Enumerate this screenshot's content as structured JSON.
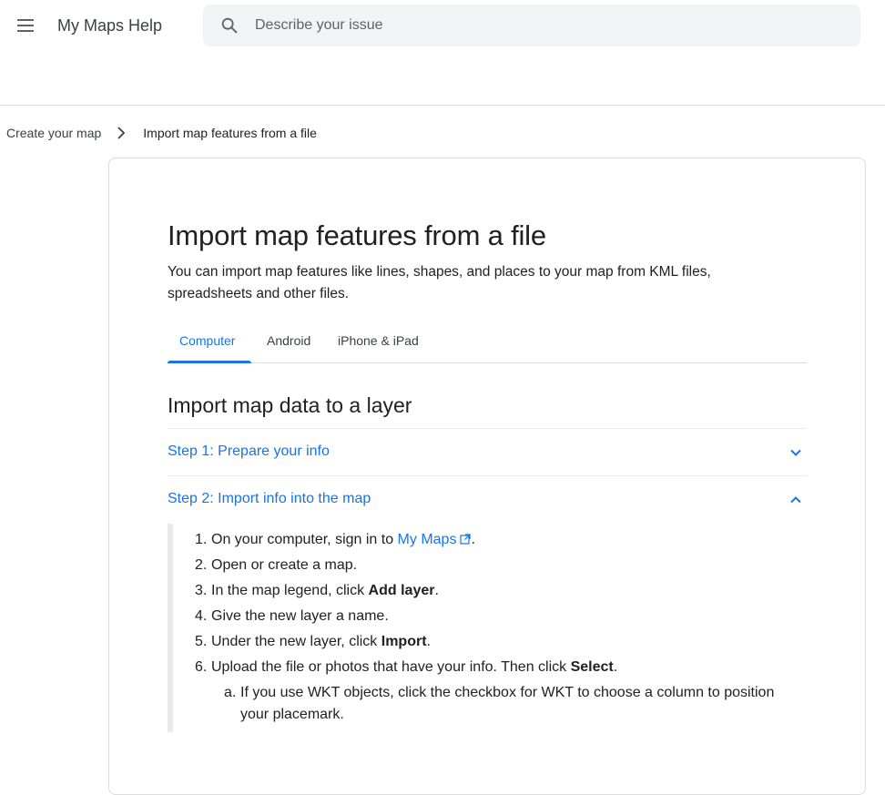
{
  "header": {
    "product_name": "My Maps Help",
    "search_placeholder": "Describe your issue"
  },
  "breadcrumb": {
    "parent": "Create your map",
    "current": "Import map features from a file"
  },
  "article": {
    "title": "Import map features from a file",
    "intro_line1": "You can import map features like lines, shapes, and places to your map from KML files,",
    "intro_line2": "spreadsheets and other files.",
    "tabs": [
      {
        "label": "Computer",
        "active": true
      },
      {
        "label": "Android",
        "active": false
      },
      {
        "label": "iPhone & iPad",
        "active": false
      }
    ],
    "section_title": "Import map data to a layer",
    "accordions": [
      {
        "label": "Step 1: Prepare your info",
        "expanded": false
      },
      {
        "label": "Step 2: Import info into the map",
        "expanded": true
      }
    ],
    "steps": {
      "s1_num": "1.",
      "s1_text": "On your computer, sign in to ",
      "s1_link": "My Maps",
      "s1_end": ".",
      "s2_num": "2.",
      "s2_text": "Open or create a map.",
      "s3_num": "3.",
      "s3_text": "In the map legend, click ",
      "s3_bold": "Add layer",
      "s3_end": ".",
      "s4_num": "4.",
      "s4_text": "Give the new layer a name.",
      "s5_num": "5.",
      "s5_text": "Under the new layer, click ",
      "s5_bold": "Import",
      "s5_end": ".",
      "s6_num": "6.",
      "s6_text": "Upload the file or photos that have your info. Then click ",
      "s6_bold": "Select",
      "s6_end": ".",
      "sa_num": "a.",
      "sa_line1": "If you use WKT objects, click the checkbox for WKT to choose a column to position",
      "sa_line2": "your placemark."
    }
  },
  "icons": {
    "menu": "menu-icon",
    "search": "search-icon",
    "breadcrumb_separator": "chevron-right-icon",
    "collapsed": "chevron-down-icon",
    "expanded": "chevron-up-icon",
    "external_link": "external-link-icon"
  },
  "colors": {
    "link": "#1a73e8",
    "search_bg": "#f1f3f4",
    "divider": "#dadce0"
  }
}
